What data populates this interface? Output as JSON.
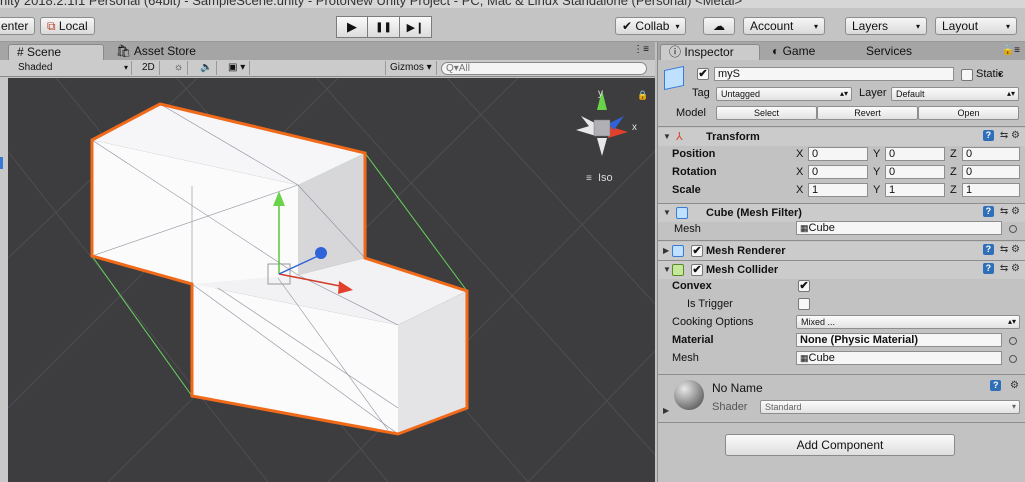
{
  "window": {
    "title": "nity 2018.2.1f1 Personal (64bit) - SampleScene.unity - ProtoNew Unity Project - PC, Mac & Linux Standalone (Personal) <Metal>"
  },
  "toolbar": {
    "pivot": "enter",
    "local": "Local",
    "play_icon": "▶",
    "pause_icon": "❚❚",
    "step_icon": "▶❙",
    "collab": "Collab",
    "account": "Account",
    "layers": "Layers",
    "layout": "Layout"
  },
  "scene": {
    "tabs": [
      "Scene",
      "Asset Store"
    ],
    "shading": "Shaded",
    "mode_2d": "2D",
    "gizmos": "Gizmos",
    "search_placeholder": "Q▾All",
    "projection": "Iso",
    "axis_y": "y",
    "axis_x": "x"
  },
  "inspector": {
    "tabs": [
      "Inspector",
      "Game",
      "Services"
    ],
    "object_name": "myS",
    "static_label": "Static",
    "tag_label": "Tag",
    "tag_value": "Untagged",
    "layer_label": "Layer",
    "layer_value": "Default",
    "model_label": "Model",
    "model_buttons": [
      "Select",
      "Revert",
      "Open"
    ],
    "transform": {
      "title": "Transform",
      "rows": [
        {
          "label": "Position",
          "x": "0",
          "y": "0",
          "z": "0"
        },
        {
          "label": "Rotation",
          "x": "0",
          "y": "0",
          "z": "0"
        },
        {
          "label": "Scale",
          "x": "1",
          "y": "1",
          "z": "1"
        }
      ],
      "axis_x": "X",
      "axis_y": "Y",
      "axis_z": "Z"
    },
    "mesh_filter": {
      "title": "Cube (Mesh Filter)",
      "mesh_label": "Mesh",
      "mesh_value": "Cube"
    },
    "mesh_renderer": {
      "title": "Mesh Renderer"
    },
    "mesh_collider": {
      "title": "Mesh Collider",
      "convex_label": "Convex",
      "convex_checked": "✔",
      "is_trigger_label": "Is Trigger",
      "cooking_label": "Cooking Options",
      "cooking_value": "Mixed ...",
      "material_label": "Material",
      "material_value": "None (Physic Material)",
      "mesh_label": "Mesh",
      "mesh_value": "Cube"
    },
    "material": {
      "name": "No Name",
      "shader_label": "Shader",
      "shader_value": "Standard"
    },
    "add_component": "Add Component"
  },
  "colors": {
    "accent": "#3a78d6",
    "selection_outline": "#f06a1a",
    "viewport_bg": "#3d3d3f"
  }
}
